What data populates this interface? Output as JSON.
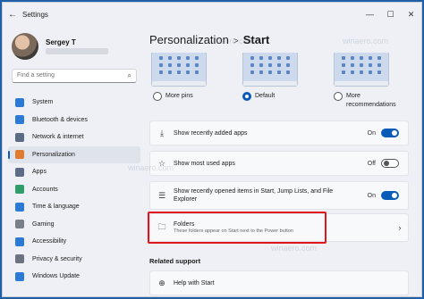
{
  "window": {
    "title": "Settings",
    "minimize": "—",
    "maximize": "☐",
    "close": "✕",
    "back": "←"
  },
  "profile": {
    "name": "Sergey T"
  },
  "search": {
    "placeholder": "Find a setting"
  },
  "sidebar": {
    "items": [
      {
        "label": "System",
        "icon": "system-icon",
        "color": "#2b7bd6"
      },
      {
        "label": "Bluetooth & devices",
        "icon": "bluetooth-icon",
        "color": "#2b7bd6"
      },
      {
        "label": "Network & internet",
        "icon": "network-icon",
        "color": "#5a6b86"
      },
      {
        "label": "Personalization",
        "icon": "brush-icon",
        "color": "#e07a2f",
        "active": true
      },
      {
        "label": "Apps",
        "icon": "apps-icon",
        "color": "#5b6b88"
      },
      {
        "label": "Accounts",
        "icon": "accounts-icon",
        "color": "#2f9e68"
      },
      {
        "label": "Time & language",
        "icon": "globe-icon",
        "color": "#2b7bd6"
      },
      {
        "label": "Gaming",
        "icon": "gaming-icon",
        "color": "#7a7f8a"
      },
      {
        "label": "Accessibility",
        "icon": "accessibility-icon",
        "color": "#2b7bd6"
      },
      {
        "label": "Privacy & security",
        "icon": "shield-icon",
        "color": "#6b7280"
      },
      {
        "label": "Windows Update",
        "icon": "update-icon",
        "color": "#2b7bd6"
      }
    ]
  },
  "breadcrumb": {
    "parent": "Personalization",
    "separator": ">",
    "current": "Start"
  },
  "layout_options": [
    {
      "label": "More pins",
      "selected": false
    },
    {
      "label": "Default",
      "selected": true
    },
    {
      "label": "More recommendations",
      "selected": false
    }
  ],
  "settings": [
    {
      "label": "Show recently added apps",
      "state": "On",
      "on": true,
      "icon": "download-icon"
    },
    {
      "label": "Show most used apps",
      "state": "Off",
      "on": false,
      "icon": "star-icon"
    },
    {
      "label": "Show recently opened items in Start, Jump Lists, and File Explorer",
      "state": "On",
      "on": true,
      "icon": "list-icon"
    },
    {
      "label": "Folders",
      "description": "These folders appear on Start next to the Power button",
      "icon": "folder-icon",
      "chevron": "›"
    }
  ],
  "related": {
    "title": "Related support",
    "item": "Help with Start"
  },
  "watermark": "winaero.com",
  "accent": "#0a5bb8",
  "highlight": "#e0161e"
}
